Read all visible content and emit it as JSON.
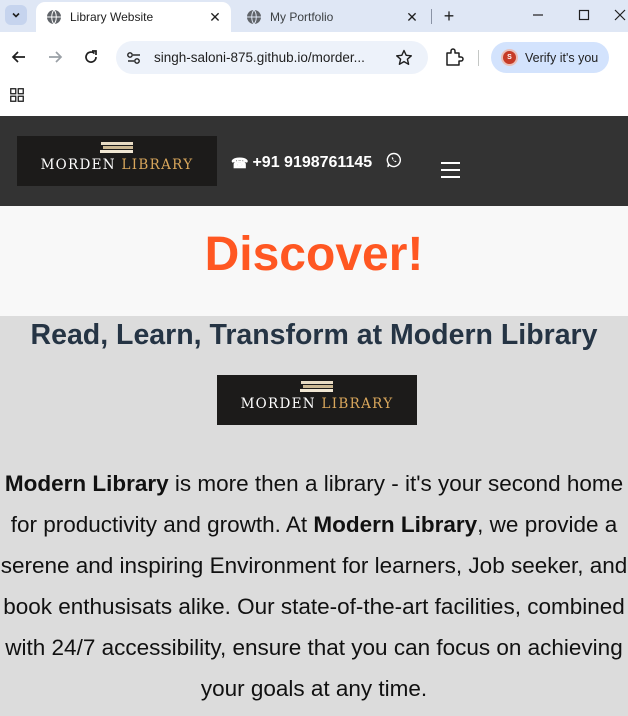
{
  "browser": {
    "tabs": [
      {
        "title": "Library Website",
        "active": true
      },
      {
        "title": "My Portfolio",
        "active": false
      }
    ],
    "url": "singh-saloni-875.github.io/morder...",
    "profile_button_label": "Verify it's you",
    "profile_avatar_letter": "S"
  },
  "header": {
    "logo": {
      "word1": "MORDEN",
      "word2": "LIBRARY"
    },
    "phone": "+91 9198761145"
  },
  "hero": {
    "heading": "Discover!",
    "heading_color": "#ff5722"
  },
  "about": {
    "heading": "Read, Learn, Transform at Modern Library",
    "logo": {
      "word1": "MORDEN",
      "word2": "LIBRARY"
    },
    "paragraph": {
      "strong1": "Modern Library",
      "text1": " is more then a library - it's your second home for productivity and growth. At ",
      "strong2": "Modern Library",
      "text2": ", we provide a serene and inspiring Environment for learners, Job seeker, and book enthusisats alike. Our state-of-the-art facilities, combined with 24/7 accessibility, ensure that you can focus on achieving your goals at any time."
    }
  },
  "colors": {
    "header_bg": "#333333",
    "hero_bg": "#f8f8f8",
    "content_bg": "#dcdcdc",
    "logo_gold": "#d9a75c"
  }
}
